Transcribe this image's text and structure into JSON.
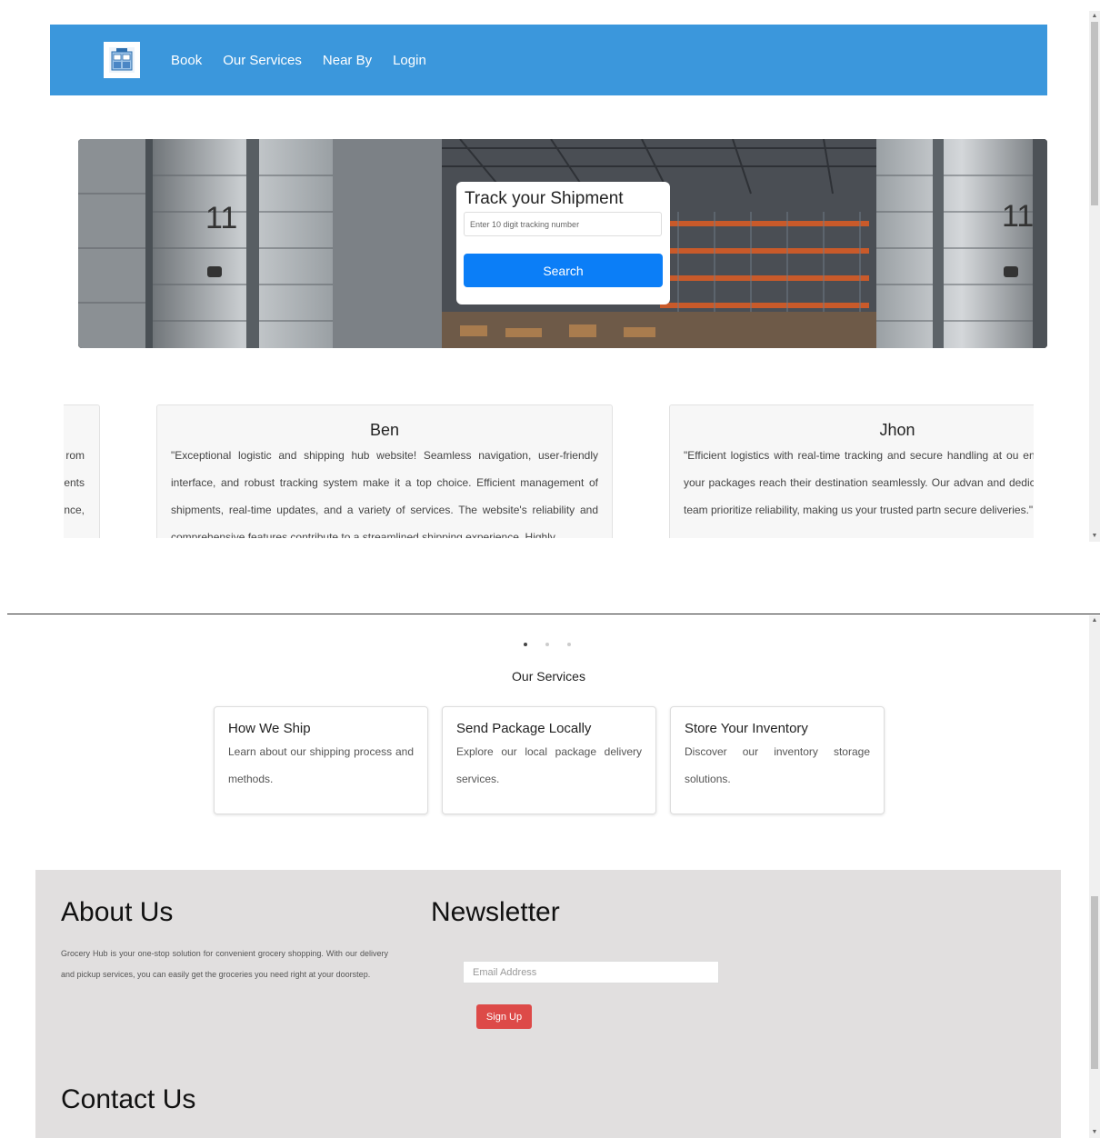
{
  "nav": {
    "links": [
      "Book",
      "Our Services",
      "Near By",
      "Login"
    ]
  },
  "tracking": {
    "title": "Track your Shipment",
    "placeholder": "Enter 10 digit tracking number",
    "search_label": "Search"
  },
  "testimonials": {
    "left_partial_lines": [
      "rom",
      "ents",
      "nce,"
    ],
    "cards": [
      {
        "name": "Ben",
        "text": "\"Exceptional logistic and shipping hub website! Seamless navigation, user-friendly interface, and robust tracking system make it a top choice. Efficient management of shipments, real-time updates, and a variety of services. The website's reliability and comprehensive features contribute to a streamlined shipping experience. Highly"
      },
      {
        "name": "Jhon",
        "text": "\"Efficient logistics with real-time tracking and secure handling at ou ensure your packages reach their destination seamlessly. Our advan and dedicated team prioritize reliability, making us your trusted partn secure deliveries.\""
      }
    ]
  },
  "carousel": {
    "active_index": 0,
    "count": 3
  },
  "services": {
    "heading": "Our Services",
    "cards": [
      {
        "title": "How We Ship",
        "desc": "Learn about our shipping process and methods."
      },
      {
        "title": "Send Package Locally",
        "desc": "Explore our local package delivery services."
      },
      {
        "title": "Store Your Inventory",
        "desc": "Discover our inventory storage solutions."
      }
    ]
  },
  "footer": {
    "about_title": "About Us",
    "about_text": "Grocery Hub is your one-stop solution for convenient grocery shopping. With our delivery and pickup services, you can easily get the groceries you need right at your doorstep.",
    "newsletter_title": "Newsletter",
    "email_placeholder": "Email Address",
    "signup_label": "Sign Up",
    "contact_title": "Contact Us"
  },
  "colors": {
    "navbar": "#3b97dc",
    "search_button": "#0b7ef7",
    "signup_button": "#dd4a48",
    "footer_bg": "#e1dfdf"
  }
}
